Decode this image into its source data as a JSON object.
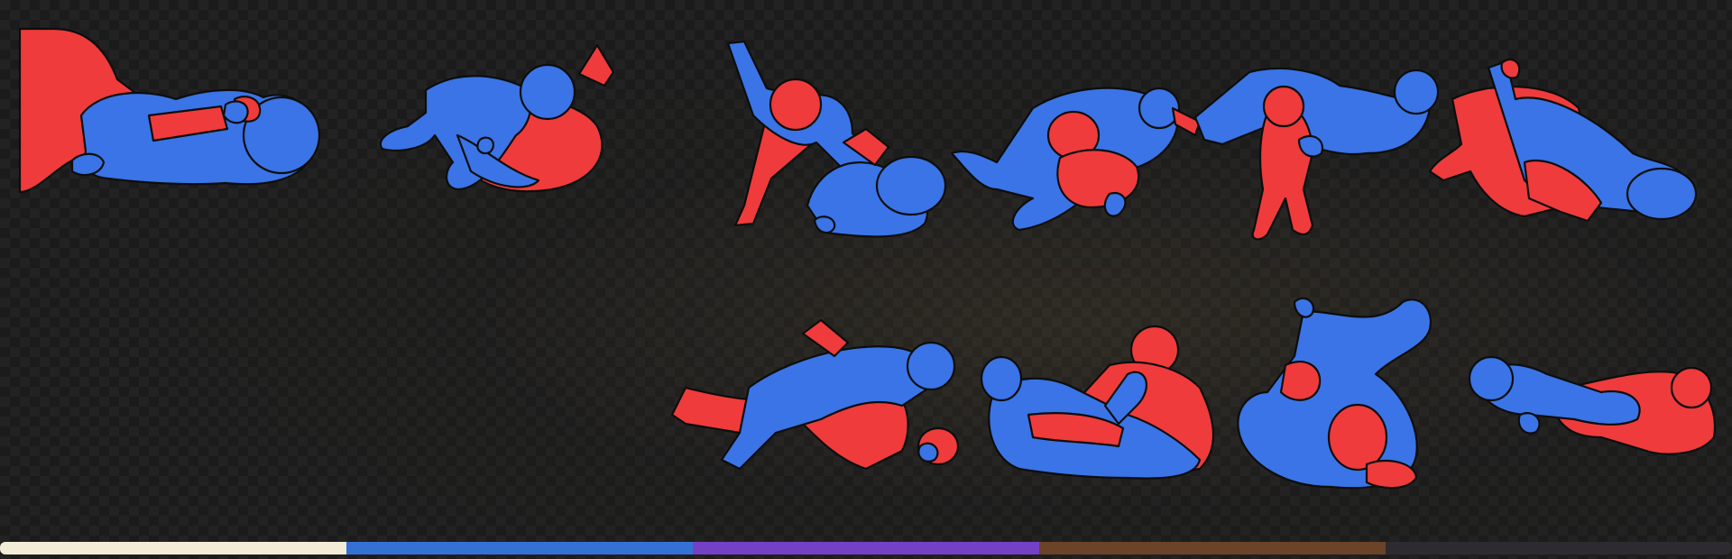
{
  "poses": [
    {
      "id": "pose-1",
      "name": "pose-card-1",
      "palette": [
        "#ef3b3b",
        "#3a74e6"
      ]
    },
    {
      "id": "pose-2",
      "name": "pose-card-2",
      "palette": [
        "#3a74e6",
        "#ef3b3b"
      ]
    },
    {
      "id": "pose-3",
      "name": "pose-card-3",
      "palette": [
        "#ef3b3b",
        "#3a74e6"
      ]
    },
    {
      "id": "pose-4",
      "name": "pose-card-4",
      "palette": [
        "#3a74e6",
        "#ef3b3b"
      ]
    },
    {
      "id": "pose-5",
      "name": "pose-card-5",
      "palette": [
        "#ef3b3b",
        "#3a74e6"
      ]
    },
    {
      "id": "pose-6",
      "name": "pose-card-6",
      "palette": [
        "#ef3b3b",
        "#3a74e6"
      ]
    },
    {
      "id": "pose-7",
      "name": "pose-card-7",
      "palette": [
        "#3a74e6",
        "#ef3b3b"
      ]
    },
    {
      "id": "pose-8",
      "name": "pose-card-8",
      "palette": [
        "#3a74e6",
        "#ef3b3b"
      ]
    },
    {
      "id": "pose-9",
      "name": "pose-card-9",
      "palette": [
        "#3a74e6",
        "#ef3b3b"
      ]
    },
    {
      "id": "pose-10",
      "name": "pose-card-10",
      "palette": [
        "#3a74e6",
        "#ef3b3b"
      ]
    }
  ],
  "colors": {
    "fighter_red": "#ef3b3b",
    "fighter_blue": "#3a74e6",
    "background": "#1e1e1e",
    "belt_white": "#f3ecd6",
    "belt_blue": "#3570d4",
    "belt_purple": "#7440c6",
    "belt_brown": "#6b4328",
    "belt_black": "#2e2b30"
  },
  "belt_bar": [
    {
      "name": "belt-white-segment",
      "color": "#f3ecd6"
    },
    {
      "name": "belt-blue-segment",
      "color": "#3570d4"
    },
    {
      "name": "belt-purple-segment",
      "color": "#7440c6"
    },
    {
      "name": "belt-brown-segment",
      "color": "#6b4328"
    },
    {
      "name": "belt-black-segment",
      "color": "#2e2b30"
    }
  ]
}
